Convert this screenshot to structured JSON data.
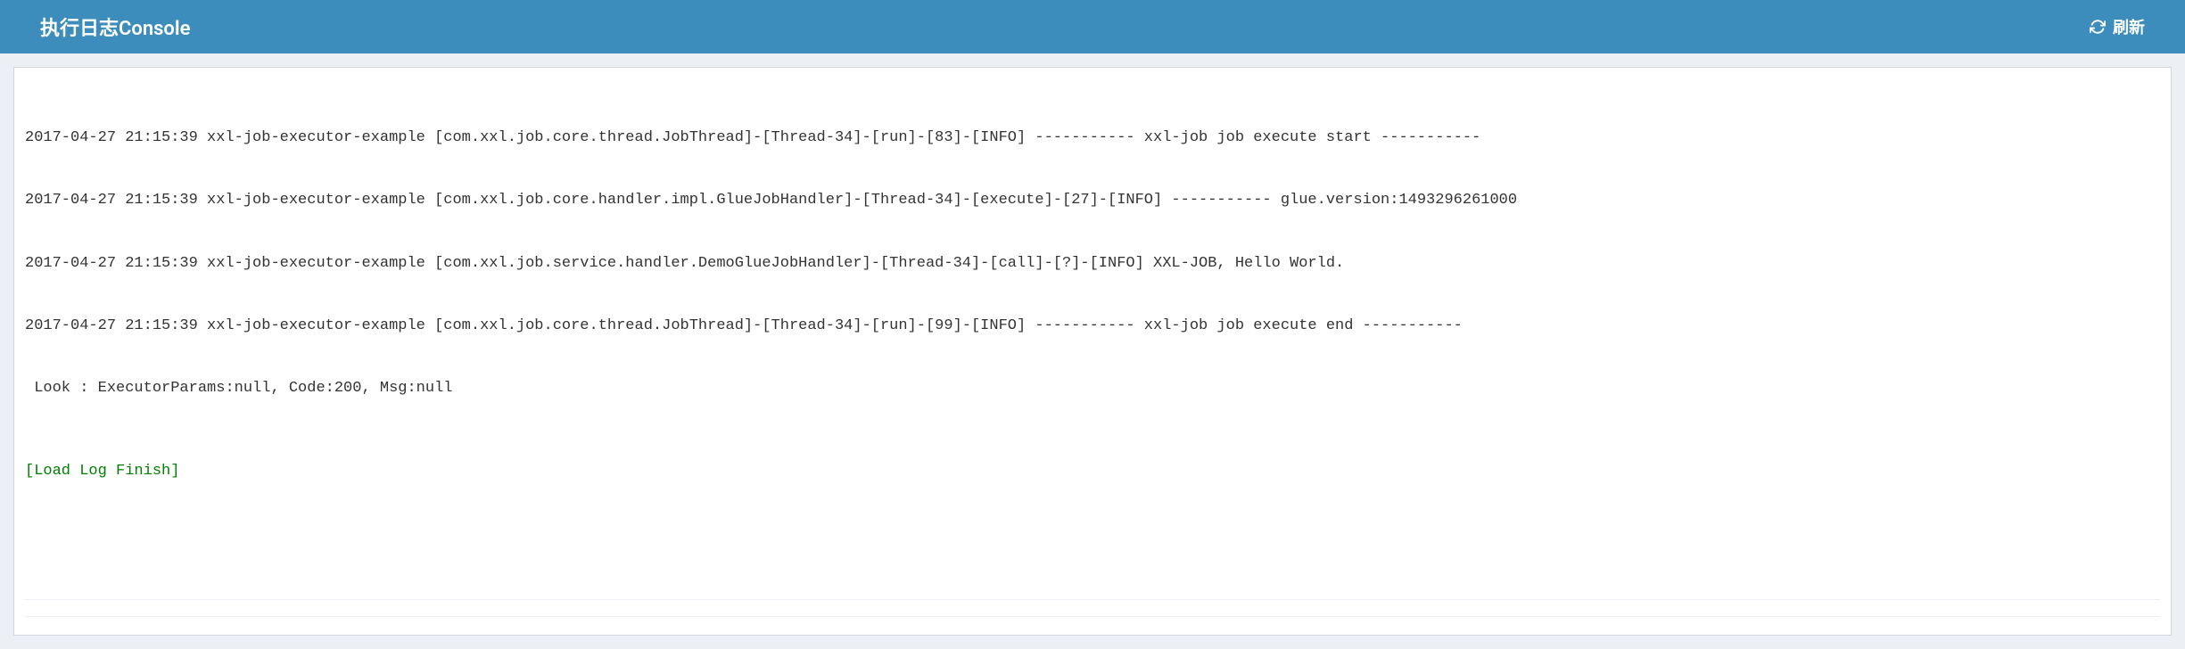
{
  "header": {
    "title": "执行日志Console",
    "refresh_label": "刷新"
  },
  "log": {
    "lines": [
      "2017-04-27 21:15:39 xxl-job-executor-example [com.xxl.job.core.thread.JobThread]-[Thread-34]-[run]-[83]-[INFO] ----------- xxl-job job execute start -----------",
      "2017-04-27 21:15:39 xxl-job-executor-example [com.xxl.job.core.handler.impl.GlueJobHandler]-[Thread-34]-[execute]-[27]-[INFO] ----------- glue.version:1493296261000",
      "2017-04-27 21:15:39 xxl-job-executor-example [com.xxl.job.service.handler.DemoGlueJobHandler]-[Thread-34]-[call]-[?]-[INFO] XXL-JOB, Hello World.",
      "2017-04-27 21:15:39 xxl-job-executor-example [com.xxl.job.core.thread.JobThread]-[Thread-34]-[run]-[99]-[INFO] ----------- xxl-job job execute end -----------",
      " Look : ExecutorParams:null, Code:200, Msg:null"
    ],
    "finish_label": "[Load Log Finish]"
  }
}
